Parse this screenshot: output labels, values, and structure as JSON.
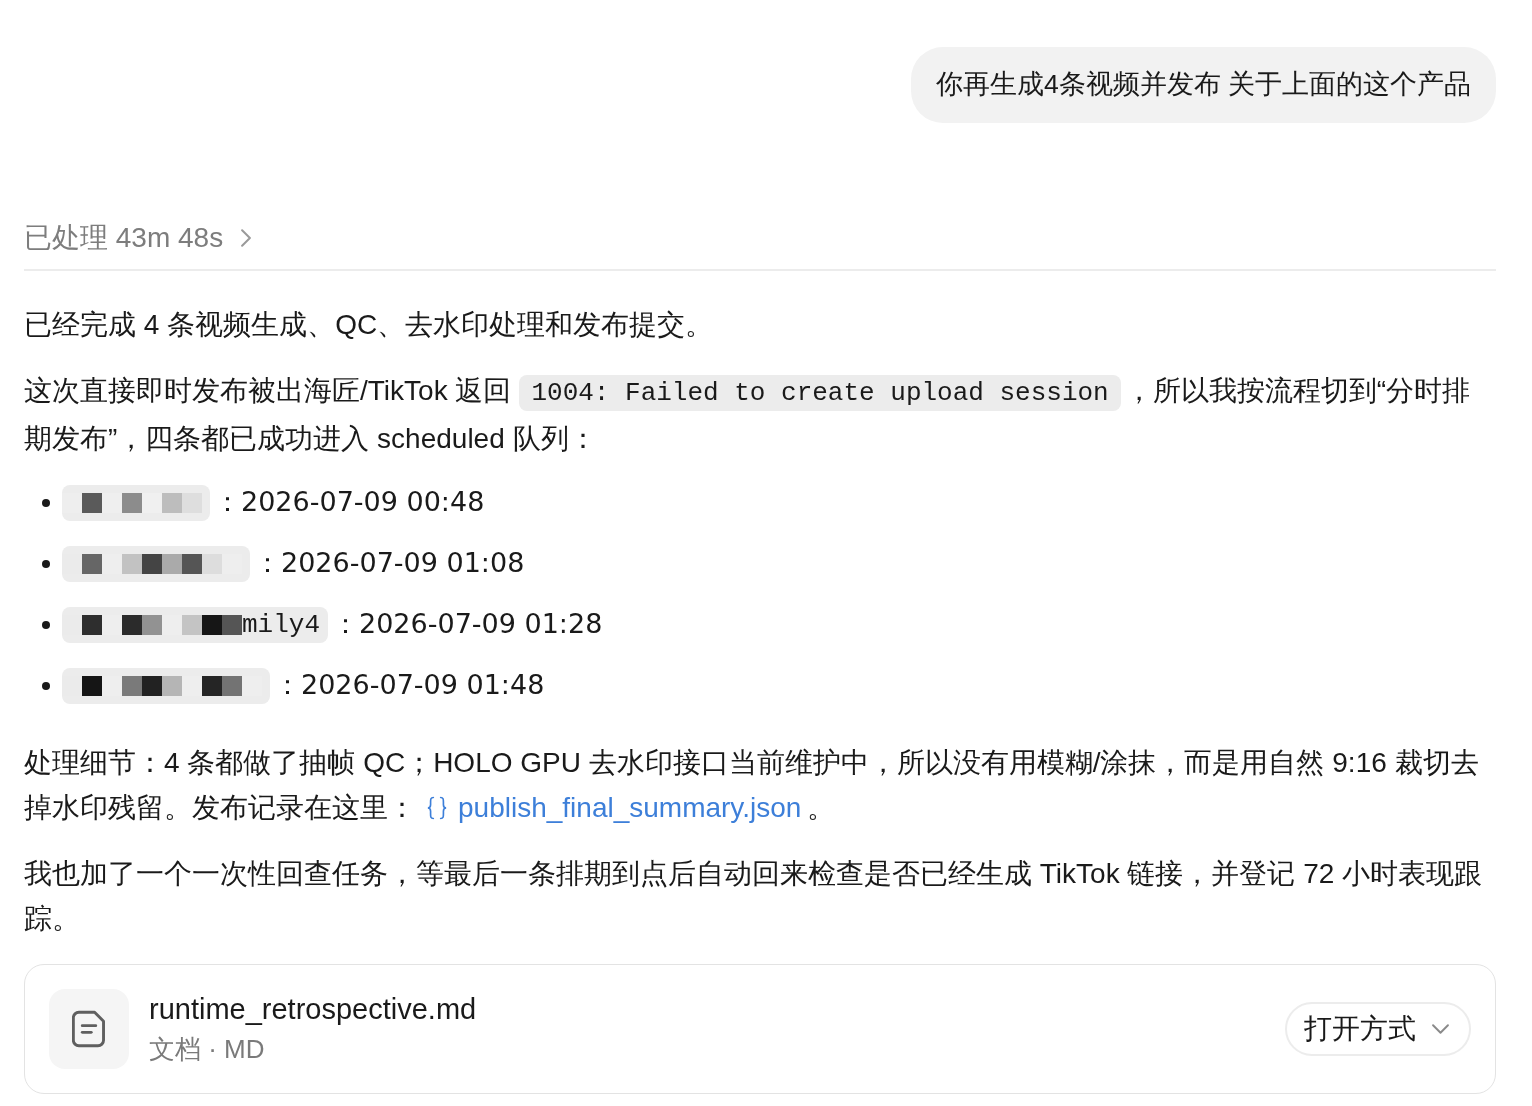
{
  "user_message": {
    "text": "你再生成4条视频并发布 关于上面的这个产品"
  },
  "processing": {
    "label": "已处理 43m 48s",
    "expanded": false
  },
  "blocks": [
    {
      "kind": "paragraph",
      "parts": [
        {
          "kind": "text",
          "text": "已经完成 4 条视频生成、QC、去水印处理和发布提交。"
        }
      ]
    },
    {
      "kind": "paragraph",
      "parts": [
        {
          "kind": "text",
          "text": "这次直接即时发布被出海匠/TikTok 返回"
        },
        {
          "kind": "code",
          "text": "1004: Failed to create upload session"
        },
        {
          "kind": "text",
          "text": "，所以我按流程切到“分时排期发布”，四条都已成功进入 scheduled 队列："
        }
      ]
    },
    {
      "kind": "list",
      "items": [
        {
          "time": "：2026-07-09 00:48"
        },
        {
          "time": "：2026-07-09 01:08"
        },
        {
          "label_tail": "mily4",
          "time": "：2026-07-09 01:28"
        },
        {
          "time": "：2026-07-09 01:48"
        }
      ]
    },
    {
      "kind": "paragraph",
      "parts": [
        {
          "kind": "text",
          "text": "处理细节：4 条都做了抽帧 QC；HOLO GPU 去水印接口当前维护中，所以没有用模糊/涂抹，而是用自然 9:16 裁切去掉水印残留。发布记录在这里："
        },
        {
          "kind": "link",
          "text": "publish_final_summary.json"
        },
        {
          "kind": "text",
          "text": "。"
        }
      ]
    },
    {
      "kind": "paragraph",
      "parts": [
        {
          "kind": "text",
          "text": "我也加了一个一次性回查任务，等最后一条排期到点后自动回来检查是否已经生成 TikTok 链接，并登记 72 小时表现跟踪。"
        }
      ]
    },
    {
      "kind": "file_card",
      "name": "runtime_retrospective.md",
      "meta": "文档 · MD",
      "action": "打开方式"
    }
  ]
}
